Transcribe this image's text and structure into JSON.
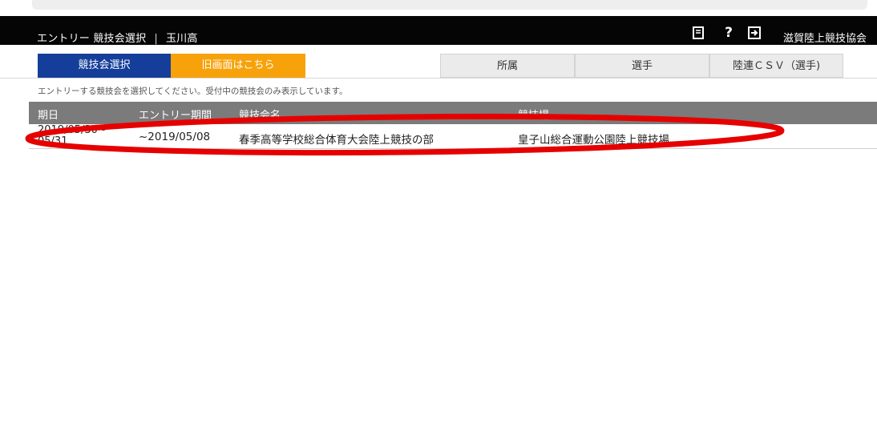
{
  "header": {
    "breadcrumb": "エントリー 競技会選択",
    "separator": "|",
    "school": "玉川高",
    "association": "滋賀陸上競技協会"
  },
  "tabs": {
    "select_meet": "競技会選択",
    "old_screen": "旧画面はこちら",
    "affiliation": "所属",
    "athlete": "選手",
    "csv": "陸連ＣＳＶ（選手)"
  },
  "instruction": "エントリーする競技会を選択してください。受付中の競技会のみ表示しています。",
  "table": {
    "columns": [
      "期日",
      "エントリー期間",
      "競技会名",
      "競技場"
    ],
    "rows": [
      {
        "date": "2019/05/30~",
        "date_cont": "05/31",
        "entry_period": "~2019/05/08",
        "meet_name": "春季高等学校総合体育大会陸上競技の部",
        "venue": "皇子山総合運動公園陸上競技場"
      }
    ]
  },
  "colors": {
    "header_bg": "#050505",
    "tab_active": "#153e9a",
    "tab_old": "#f7a20a",
    "table_header": "#7b7b7b",
    "annotation": "#e60000"
  },
  "icons": [
    "book-icon",
    "help-icon",
    "logout-icon"
  ]
}
